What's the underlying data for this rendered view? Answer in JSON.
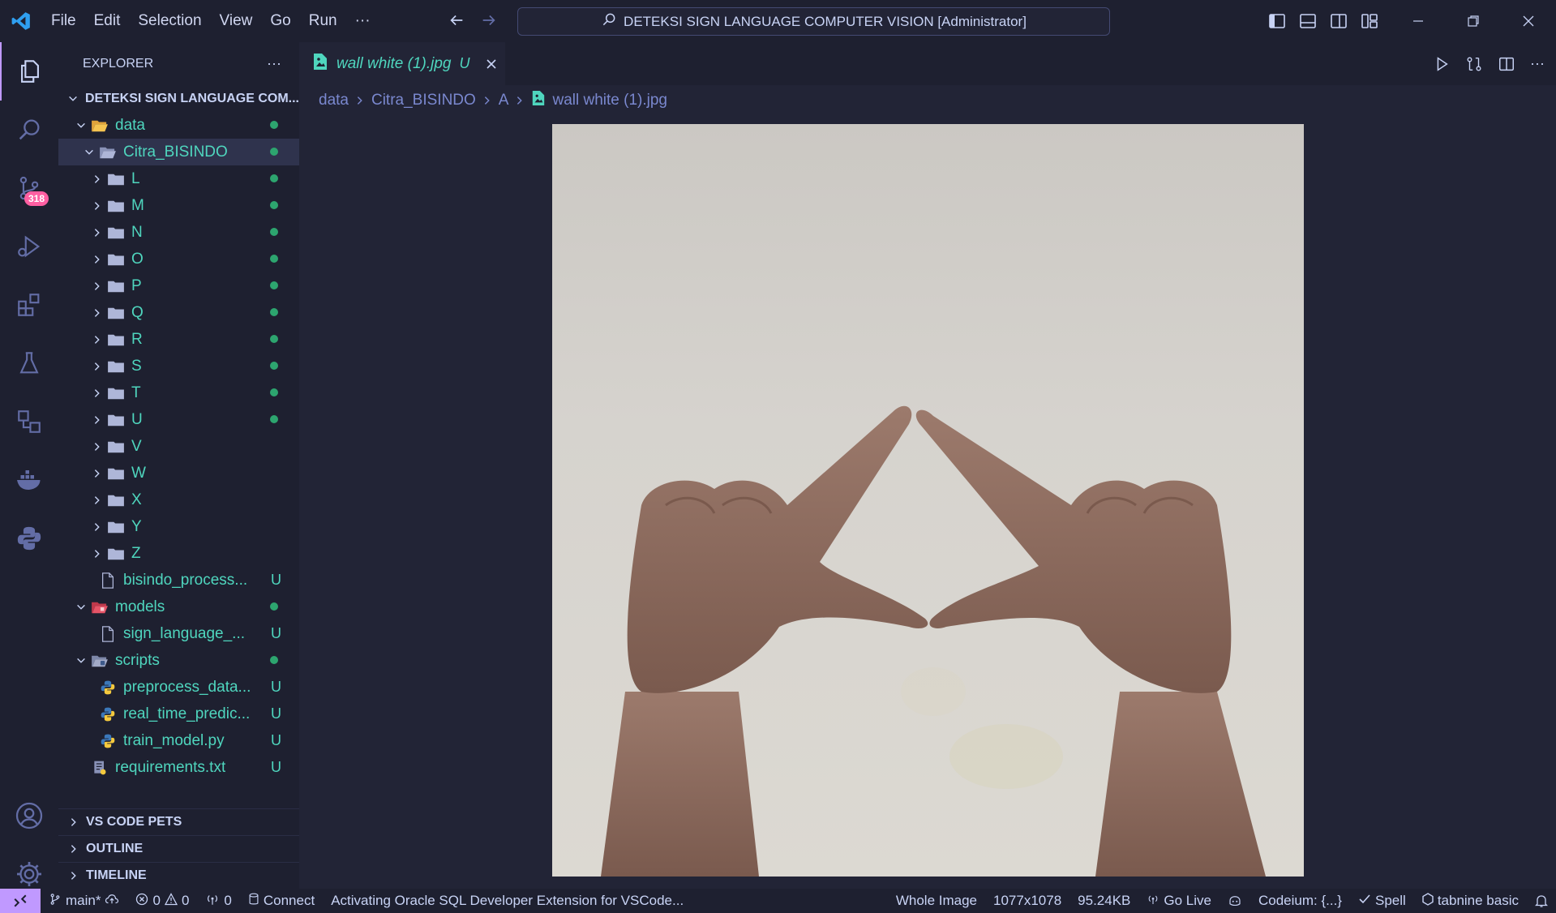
{
  "titlebar": {
    "menu": [
      "File",
      "Edit",
      "Selection",
      "View",
      "Go",
      "Run"
    ],
    "more_label": "···",
    "command_center": "DETEKSI SIGN LANGUAGE COMPUTER VISION [Administrator]"
  },
  "activitybar": {
    "scm_badge": "318"
  },
  "sidebar": {
    "title": "EXPLORER",
    "more_label": "···",
    "root": "DETEKSI SIGN LANGUAGE COM...",
    "tree": {
      "data": "data",
      "citra": "Citra_BISINDO",
      "folders": [
        "L",
        "M",
        "N",
        "O",
        "P",
        "Q",
        "R",
        "S",
        "T",
        "U",
        "V",
        "W",
        "X",
        "Y",
        "Z"
      ],
      "bisindo_file": "bisindo_process...",
      "models": "models",
      "sign_model": "sign_language_...",
      "scripts": "scripts",
      "preprocess": "preprocess_data...",
      "realtime": "real_time_predic...",
      "train": "train_model.py",
      "requirements": "requirements.txt",
      "untracked_mark": "U"
    },
    "sections": [
      "VS CODE PETS",
      "OUTLINE",
      "TIMELINE"
    ]
  },
  "editor": {
    "tab_label": "wall white (1).jpg",
    "tab_status": "U",
    "breadcrumb": [
      "data",
      "Citra_BISINDO",
      "A",
      "wall white (1).jpg"
    ]
  },
  "statusbar": {
    "branch": "main*",
    "errors": "0",
    "warnings": "0",
    "ports": "0",
    "connect": "Connect",
    "message": "Activating Oracle SQL Developer Extension for VSCode...",
    "zoom": "Whole Image",
    "dimensions": "1077x1078",
    "filesize": "95.24KB",
    "golive": "Go Live",
    "codeium": "Codeium: {...}",
    "spell": "Spell",
    "tabnine": "tabnine basic"
  },
  "colors": {
    "accent": "#c099ff",
    "git_untracked": "#4fd6be",
    "git_dot": "#2da56f",
    "badge": "#ff5fa2"
  }
}
